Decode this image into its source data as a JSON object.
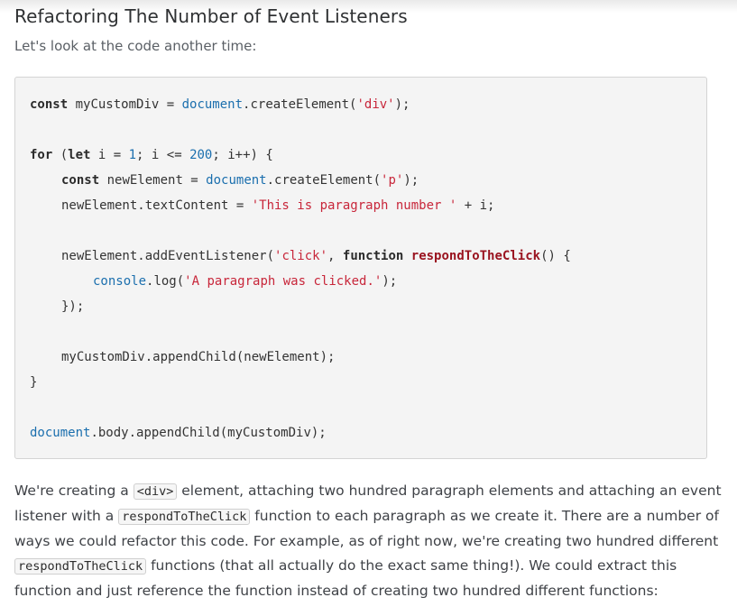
{
  "article": {
    "heading": "Refactoring The Number of Event Listeners",
    "intro": "Let's look at the code another time:",
    "code": {
      "l1_const": "const",
      "l1_a": " myCustomDiv = ",
      "l1_doc": "document",
      "l1_b": ".createElement(",
      "l1_str": "'div'",
      "l1_c": ");",
      "l2_for": "for",
      "l2_a": " (",
      "l2_let": "let",
      "l2_b": " i = ",
      "l2_n1": "1",
      "l2_c": "; i <= ",
      "l2_n2": "200",
      "l2_d": "; i++) {",
      "l3_const": "const",
      "l3_a": " newElement = ",
      "l3_doc": "document",
      "l3_b": ".createElement(",
      "l3_str": "'p'",
      "l3_c": ");",
      "l4_a": "newElement.textContent = ",
      "l4_str": "'This is paragraph number '",
      "l4_b": " + i;",
      "l5_a": "newElement.addEventListener(",
      "l5_str": "'click'",
      "l5_b": ", ",
      "l5_function": "function",
      "l5_c": " ",
      "l5_fname": "respondToTheClick",
      "l5_d": "() {",
      "l6_console": "console",
      "l6_a": ".log(",
      "l6_str": "'A paragraph was clicked.'",
      "l6_b": ");",
      "l7": "});",
      "l8": "myCustomDiv.appendChild(newElement);",
      "l9": "}",
      "l10_doc": "document",
      "l10_a": ".body.appendChild(myCustomDiv);"
    },
    "paragraph": {
      "t1": "We're creating a ",
      "c1": "<div>",
      "t2": " element, attaching two hundred paragraph elements and attaching an event listener with a ",
      "c2": "respondToTheClick",
      "t3": " function to each paragraph as we create it. There are a number of ways we could refactor this code. For example, as of right now, we're creating two hundred different ",
      "c3": "respondToTheClick",
      "t4": " functions (that all actually do the exact same thing!). We could extract this function and just reference the function instead of creating two hundred different functions:"
    }
  }
}
